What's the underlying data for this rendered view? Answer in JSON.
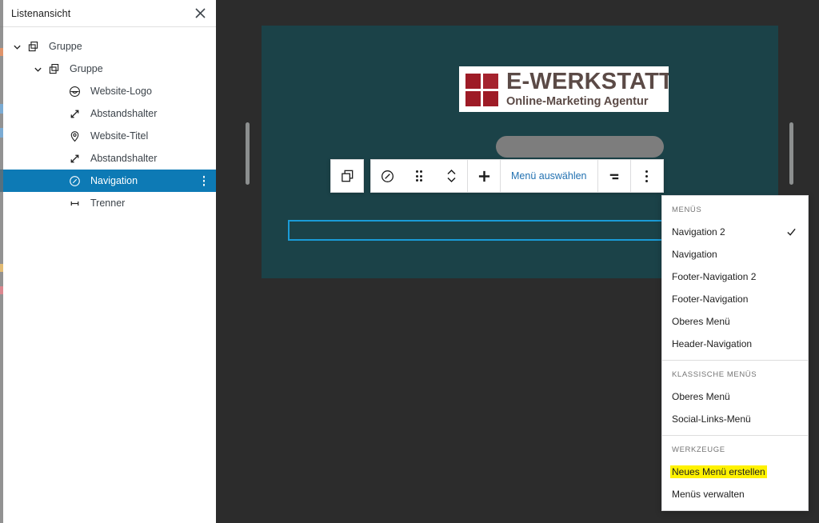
{
  "sidebar": {
    "title": "Listenansicht",
    "close_icon": "close-icon",
    "items": [
      {
        "label": "Gruppe",
        "icon": "group-block-icon",
        "indent": 0,
        "chevron": "chevron-down-icon",
        "selected": false
      },
      {
        "label": "Gruppe",
        "icon": "group-block-icon",
        "indent": 1,
        "chevron": "chevron-down-icon",
        "selected": false
      },
      {
        "label": "Website-Logo",
        "icon": "site-logo-icon",
        "indent": 2,
        "chevron": "",
        "selected": false
      },
      {
        "label": "Abstandshalter",
        "icon": "spacer-icon",
        "indent": 2,
        "chevron": "",
        "selected": false
      },
      {
        "label": "Website-Titel",
        "icon": "site-title-pin-icon",
        "indent": 2,
        "chevron": "",
        "selected": false
      },
      {
        "label": "Abstandshalter",
        "icon": "spacer-icon",
        "indent": 2,
        "chevron": "",
        "selected": false
      },
      {
        "label": "Navigation",
        "icon": "navigation-icon",
        "indent": 2,
        "chevron": "",
        "selected": true
      },
      {
        "label": "Trenner",
        "icon": "separator-icon",
        "indent": 2,
        "chevron": "",
        "selected": false
      }
    ]
  },
  "canvas": {
    "background_color": "#1b4248",
    "logo": {
      "main_text": "E-WERKSTATT",
      "sub_text": "Online-Marketing  Agentur",
      "square_color": "#9e1b26",
      "text_color": "#5b4a46"
    },
    "redaction_label": "redacted-block",
    "resize_handle_left": "canvas-resize-handle-left",
    "resize_handle_right": "canvas-resize-handle-right"
  },
  "toolbar": {
    "parent_block_icon": "group-block-icon",
    "block_type_icon": "navigation-icon",
    "drag_handle_icon": "drag-handle-icon",
    "move_icon": "move-up-down-icon",
    "add_icon": "plus-icon",
    "select_menu_label": "Menü auswählen",
    "align_icon": "justify-items-icon",
    "options_icon": "more-options-icon"
  },
  "block": {
    "appender_icon": "plus-icon",
    "outline_color": "#1a9bd7"
  },
  "dropdown": {
    "sections": [
      {
        "heading": "MENÜS",
        "items": [
          {
            "label": "Navigation 2",
            "checked": true,
            "highlighted": false
          },
          {
            "label": "Navigation",
            "checked": false,
            "highlighted": false
          },
          {
            "label": "Footer-Navigation 2",
            "checked": false,
            "highlighted": false
          },
          {
            "label": "Footer-Navigation",
            "checked": false,
            "highlighted": false
          },
          {
            "label": "Oberes Menü",
            "checked": false,
            "highlighted": false
          },
          {
            "label": "Header-Navigation",
            "checked": false,
            "highlighted": false
          }
        ]
      },
      {
        "heading": "KLASSISCHE MENÜS",
        "items": [
          {
            "label": "Oberes Menü",
            "checked": false,
            "highlighted": false
          },
          {
            "label": "Social-Links-Menü",
            "checked": false,
            "highlighted": false
          }
        ]
      },
      {
        "heading": "WERKZEUGE",
        "items": [
          {
            "label": "Neues Menü erstellen",
            "checked": false,
            "highlighted": true
          },
          {
            "label": "Menüs verwalten",
            "checked": false,
            "highlighted": false
          }
        ]
      }
    ],
    "highlight_color": "#fff200",
    "check_icon": "check-icon"
  }
}
